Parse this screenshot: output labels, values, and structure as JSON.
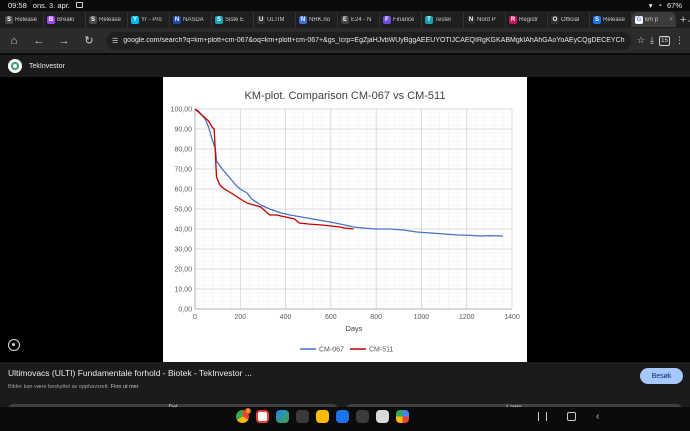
{
  "status_bar": {
    "time": "09:58",
    "date": "ons. 3. apr.",
    "battery": "67%"
  },
  "tabs": [
    {
      "label": "Release",
      "fav": "S",
      "color": "#4a4a4a"
    },
    {
      "label": "Breaki",
      "fav": "B",
      "color": "#a142f4"
    },
    {
      "label": "Release",
      "fav": "S",
      "color": "#4a4a4a"
    },
    {
      "label": "Yr - Pro",
      "fav": "Y",
      "color": "#00b9f1"
    },
    {
      "label": "NASDA",
      "fav": "N",
      "color": "#1f4aa8"
    },
    {
      "label": "Siste E",
      "fav": "S",
      "color": "#1aa3b5"
    },
    {
      "label": "ULTIM",
      "fav": "U",
      "color": "#333333"
    },
    {
      "label": "NRK.no",
      "fav": "N",
      "color": "#3b6fe0"
    },
    {
      "label": "E24 - N",
      "fav": "E",
      "color": "#444444"
    },
    {
      "label": "Finance",
      "fav": "F",
      "color": "#6c4ee0"
    },
    {
      "label": "Tester",
      "fav": "T",
      "color": "#1aa3b5"
    },
    {
      "label": "Nord P",
      "fav": "N",
      "color": "#2b2b2b"
    },
    {
      "label": "Registr",
      "fav": "R",
      "color": "#c2185b"
    },
    {
      "label": "Official",
      "fav": "O",
      "color": "#333333"
    },
    {
      "label": "Release",
      "fav": "S",
      "color": "#1a73e8"
    },
    {
      "label": "km p",
      "fav": "G",
      "color": "#ffffff",
      "active": true
    }
  ],
  "address_bar": {
    "url": "google.com/search?q=km+plott+cm-067&oq=km+plott+cm-067+&gs_lcrp=EgZjaHJvbWUyBggAEEUYOTIJCAEQIRgKGKABMgkIAhAhGAoYoAEyCQgDECEYChigAdIBC",
    "tab_count": "15"
  },
  "source": {
    "name": "TekInvestor"
  },
  "caption": {
    "title": "Ultimovacs (ULTI) Fundamentale forhold - Biotek - TekInvestor ...",
    "subtitle": "Bilder kan være beskyttet av opphavsrett.",
    "learn_more": "Finn ut mer",
    "visit_label": "Besøk",
    "share_label": "Del",
    "save_label": "Lagre"
  },
  "colors": {
    "series1": "#4472c4",
    "series2": "#c00000",
    "visit_button": "#a8c7fa"
  },
  "chart_data": {
    "type": "line",
    "title": "KM-plot. Comparison CM-067 vs CM-511",
    "xlabel": "Days",
    "ylabel": "",
    "xlim": [
      0,
      1400
    ],
    "ylim": [
      0,
      100
    ],
    "x_ticks": [
      "0",
      "200",
      "400",
      "600",
      "800",
      "1000",
      "1200",
      "1400"
    ],
    "y_ticks": [
      "0,00",
      "10,00",
      "20,00",
      "30,00",
      "40,00",
      "50,00",
      "60,00",
      "70,00",
      "80,00",
      "90,00",
      "100,00"
    ],
    "grid": true,
    "legend": "bottom",
    "series": [
      {
        "name": "CM-067",
        "color": "#4472c4",
        "points": [
          [
            0,
            100
          ],
          [
            15,
            99
          ],
          [
            30,
            97
          ],
          [
            45,
            95
          ],
          [
            60,
            91
          ],
          [
            75,
            85
          ],
          [
            90,
            80
          ],
          [
            95,
            74
          ],
          [
            120,
            70
          ],
          [
            150,
            66
          ],
          [
            180,
            62
          ],
          [
            200,
            60
          ],
          [
            230,
            58
          ],
          [
            250,
            55
          ],
          [
            290,
            52
          ],
          [
            330,
            50
          ],
          [
            380,
            48
          ],
          [
            420,
            47
          ],
          [
            470,
            46
          ],
          [
            520,
            45
          ],
          [
            570,
            44
          ],
          [
            620,
            43
          ],
          [
            660,
            42
          ],
          [
            700,
            41
          ],
          [
            740,
            40.5
          ],
          [
            800,
            40
          ],
          [
            860,
            40
          ],
          [
            920,
            39.5
          ],
          [
            980,
            38.5
          ],
          [
            1040,
            38
          ],
          [
            1100,
            37.5
          ],
          [
            1160,
            37
          ],
          [
            1220,
            36.8
          ],
          [
            1260,
            36.5
          ],
          [
            1300,
            36.7
          ],
          [
            1360,
            36.5
          ]
        ]
      },
      {
        "name": "CM-511",
        "color": "#c00000",
        "points": [
          [
            0,
            100
          ],
          [
            20,
            98
          ],
          [
            40,
            96
          ],
          [
            60,
            94
          ],
          [
            75,
            91
          ],
          [
            85,
            90
          ],
          [
            95,
            66
          ],
          [
            110,
            62
          ],
          [
            130,
            60
          ],
          [
            160,
            58
          ],
          [
            200,
            55
          ],
          [
            230,
            53
          ],
          [
            260,
            52
          ],
          [
            290,
            51
          ],
          [
            310,
            49
          ],
          [
            330,
            47
          ],
          [
            360,
            47
          ],
          [
            400,
            46
          ],
          [
            440,
            45
          ],
          [
            460,
            43
          ],
          [
            500,
            42.5
          ],
          [
            560,
            42
          ],
          [
            600,
            41.5
          ],
          [
            640,
            41
          ],
          [
            660,
            40.5
          ],
          [
            700,
            40
          ]
        ]
      }
    ]
  }
}
